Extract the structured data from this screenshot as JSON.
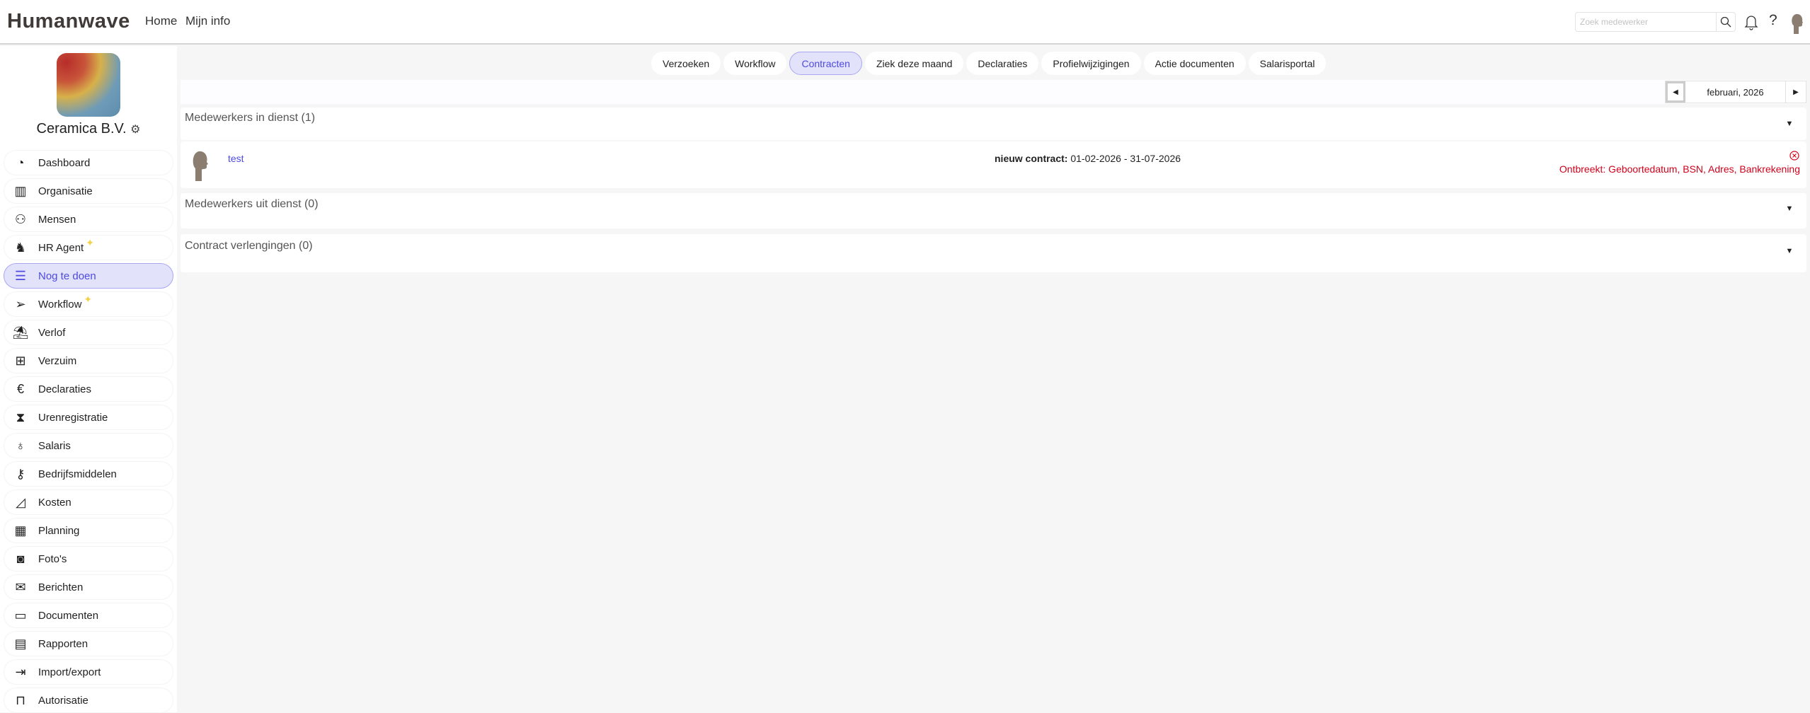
{
  "header": {
    "logo": "Humanwave",
    "nav": [
      "Home",
      "Mijn info"
    ],
    "search_placeholder": "Zoek medewerker"
  },
  "company": {
    "name": "Ceramica B.V."
  },
  "sidebar": {
    "items": [
      {
        "label": "Dashboard",
        "icon": "pie-chart-icon"
      },
      {
        "label": "Organisatie",
        "icon": "building-icon"
      },
      {
        "label": "Mensen",
        "icon": "people-icon"
      },
      {
        "label": "HR Agent",
        "icon": "monkey-icon",
        "sparkle": true
      },
      {
        "label": "Nog te doen",
        "icon": "checklist-icon",
        "active": true
      },
      {
        "label": "Workflow",
        "icon": "paper-plane-icon",
        "sparkle": true
      },
      {
        "label": "Verlof",
        "icon": "palm-tree-icon"
      },
      {
        "label": "Verzuim",
        "icon": "medical-kit-icon"
      },
      {
        "label": "Declaraties",
        "icon": "euro-icon"
      },
      {
        "label": "Urenregistratie",
        "icon": "hourglass-icon"
      },
      {
        "label": "Salaris",
        "icon": "money-bag-icon"
      },
      {
        "label": "Bedrijfsmiddelen",
        "icon": "key-icon"
      },
      {
        "label": "Kosten",
        "icon": "area-chart-icon"
      },
      {
        "label": "Planning",
        "icon": "calendar-icon"
      },
      {
        "label": "Foto's",
        "icon": "camera-icon"
      },
      {
        "label": "Berichten",
        "icon": "messages-icon"
      },
      {
        "label": "Documenten",
        "icon": "folder-icon"
      },
      {
        "label": "Rapporten",
        "icon": "report-icon"
      },
      {
        "label": "Import/export",
        "icon": "import-export-icon"
      },
      {
        "label": "Autorisatie",
        "icon": "unlock-icon"
      }
    ]
  },
  "tabs": [
    {
      "label": "Verzoeken"
    },
    {
      "label": "Workflow"
    },
    {
      "label": "Contracten",
      "active": true
    },
    {
      "label": "Ziek deze maand"
    },
    {
      "label": "Declaraties"
    },
    {
      "label": "Profielwijzigingen"
    },
    {
      "label": "Actie documenten"
    },
    {
      "label": "Salarisportal"
    }
  ],
  "date": {
    "label": "februari, 2026"
  },
  "sections": [
    {
      "title": "Medewerkers in dienst (1)"
    },
    {
      "title": "Medewerkers uit dienst (0)"
    },
    {
      "title": "Contract verlengingen (0)"
    }
  ],
  "employee": {
    "name": "test",
    "contract_label": "nieuw contract:",
    "contract_period": "01-02-2026 - 31-07-2026",
    "missing": "Ontbreekt: Geboortedatum, BSN, Adres, Bankrekening"
  },
  "colors": {
    "accent": "#4f4ae0",
    "error": "#d0021b"
  }
}
